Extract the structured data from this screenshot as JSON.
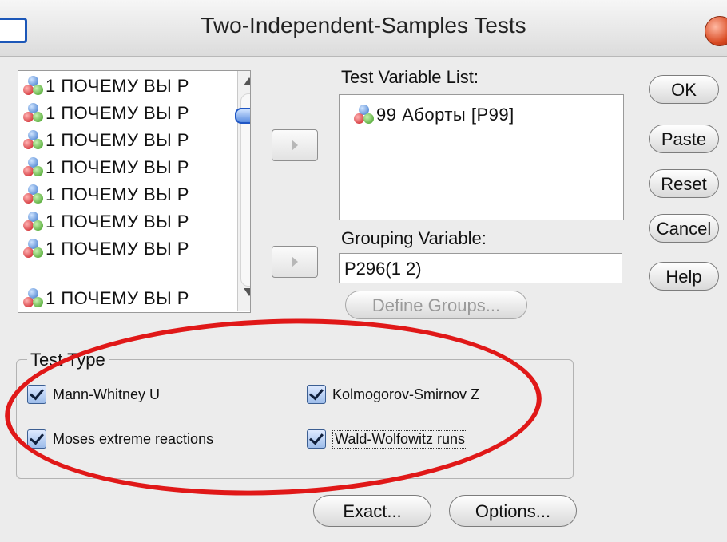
{
  "window": {
    "title": "Two-Independent-Samples Tests"
  },
  "source_list": {
    "items": [
      "1 ПОЧЕМУ ВЫ Р",
      "1 ПОЧЕМУ ВЫ Р",
      "1 ПОЧЕМУ ВЫ Р",
      "1 ПОЧЕМУ ВЫ Р",
      "1 ПОЧЕМУ ВЫ Р",
      "1 ПОЧЕМУ ВЫ Р",
      "1 ПОЧЕМУ ВЫ Р",
      "1 ПОЧЕМУ ВЫ Р"
    ],
    "item_icon": "variable-nominal-icon"
  },
  "test_variable_list": {
    "label": "Test Variable List:",
    "items": [
      "99 Аборты [P99]"
    ]
  },
  "grouping_variable": {
    "label": "Grouping Variable:",
    "value": "P296(1 2)",
    "define_groups_label": "Define Groups..."
  },
  "buttons": {
    "ok": "OK",
    "paste": "Paste",
    "reset": "Reset",
    "cancel": "Cancel",
    "help": "Help",
    "exact": "Exact...",
    "options": "Options..."
  },
  "test_type": {
    "legend": "Test Type",
    "mann_whitney": {
      "label": "Mann-Whitney U",
      "checked": true
    },
    "kolmogorov": {
      "label": "Kolmogorov-Smirnov Z",
      "checked": true
    },
    "moses": {
      "label": "Moses extreme reactions",
      "checked": true
    },
    "wald": {
      "label": "Wald-Wolfowitz runs",
      "checked": true
    }
  },
  "colors": {
    "annotation_circle": "#e01818",
    "close_button": "#d94a22"
  }
}
